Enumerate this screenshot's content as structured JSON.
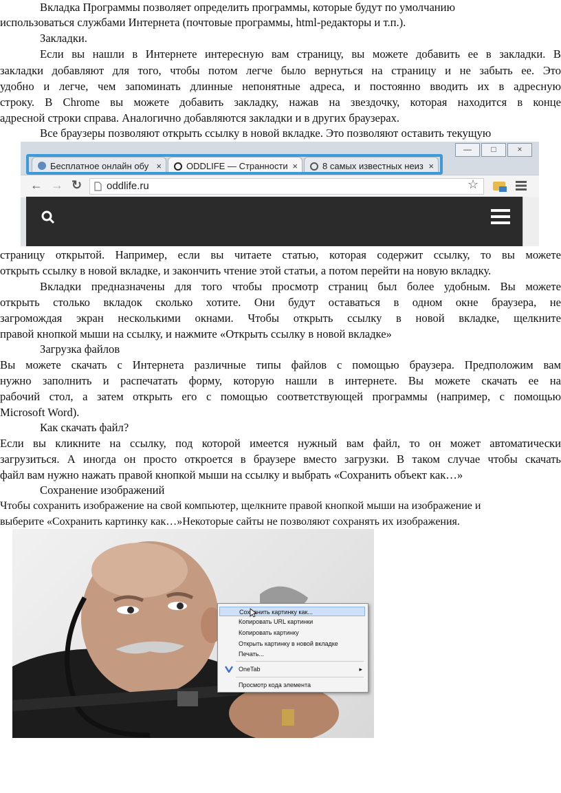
{
  "text": {
    "l1": "Вкладка Программы позволяет определить программы, которые будут по умолчанию",
    "l2": "использоваться службами Интернета (почтовые программы, html-редакторы и т.п.).",
    "h_bookmarks": "Закладки.",
    "b1": "Если вы нашли в Интернете интересную вам страницу, вы можете добавить ее в закладки. В",
    "b2": "закладки добавляют для того, чтобы потом легче было вернуться на страницу и не забыть ее. Это",
    "b3": "удобно и легче, чем запоминать длинные непонятные адреса, и постоянно вводить их в адресную",
    "b4": "строку. В Chrome вы можете добавить закладку, нажав на звездочку, которая находится в конце",
    "b5": "адресной строки справа. Аналогично добавляются закладки и в других браузерах.",
    "t1": "Все браузеры позволяют открыть ссылку в новой вкладке. Это позволяют оставить текущую",
    "t2": "страницу открытой. Например, если вы читаете статью, которая содержит ссылку, то вы можете",
    "t3": "открыть ссылку в новой вкладке, и закончить чтение этой статьи, а потом перейти на новую вкладку.",
    "t4": "Вкладки предназначены для того чтобы просмотр страниц был более удобным. Вы можете",
    "t5": "открыть столько вкладок сколько хотите. Они будут оставаться в одном окне браузера, не",
    "t6": "загромождая экран несколькими окнами. Чтобы открыть ссылку в новой вкладке, щелкните",
    "t7": "правой кнопкой мыши на ссылку, и нажмите «Открыть ссылку в новой вкладке»",
    "h_download": "Загрузка файлов",
    "d1": "Вы можете скачать с Интернета различные типы файлов с помощью браузера. Предположим вам",
    "d2": "нужно заполнить и распечатать форму, которую нашли в интернете. Вы можете скачать ее на",
    "d3": "рабочий стол, а затем открыть его с помощью соответствующей программы (например, с помощью",
    "d4": "Microsoft Word).",
    "h_how": "Как скачать файл?",
    "h1": "Если вы кликните на ссылку, под которой имеется нужный вам файл, то он может автоматически",
    "h2": "загрузиться. А иногда он просто откроется в браузере вместо загрузки. В таком случае чтобы скачать",
    "h3": "файл вам нужно нажать правой кнопкой мыши на ссылку и выбрать «Сохранить объект как…»",
    "h_save": "Сохранение изображений",
    "s1": "Чтобы сохранить изображение на свой компьютер, щелкните правой кнопкой мыши на изображение и",
    "s2": "выберите «Сохранить картинку как…»Некоторые сайты не позволяют сохранять их изображения."
  },
  "browser": {
    "tabs": [
      "Бесплатное онлайн обу",
      "ODDLIFE — Странности",
      "8 самых известных неиз"
    ],
    "address": "oddlife.ru",
    "close_glyph": "×"
  },
  "context_menu": {
    "items": [
      "Сохранить картинку как...",
      "Копировать URL картинки",
      "Копировать картинку",
      "Открыть картинку в новой вкладке",
      "Печать...",
      "OneTab",
      "Просмотр кода элемента"
    ]
  },
  "colors": {
    "highlight": "#3d9ad8",
    "dark_bar": "#2b2b2b"
  }
}
